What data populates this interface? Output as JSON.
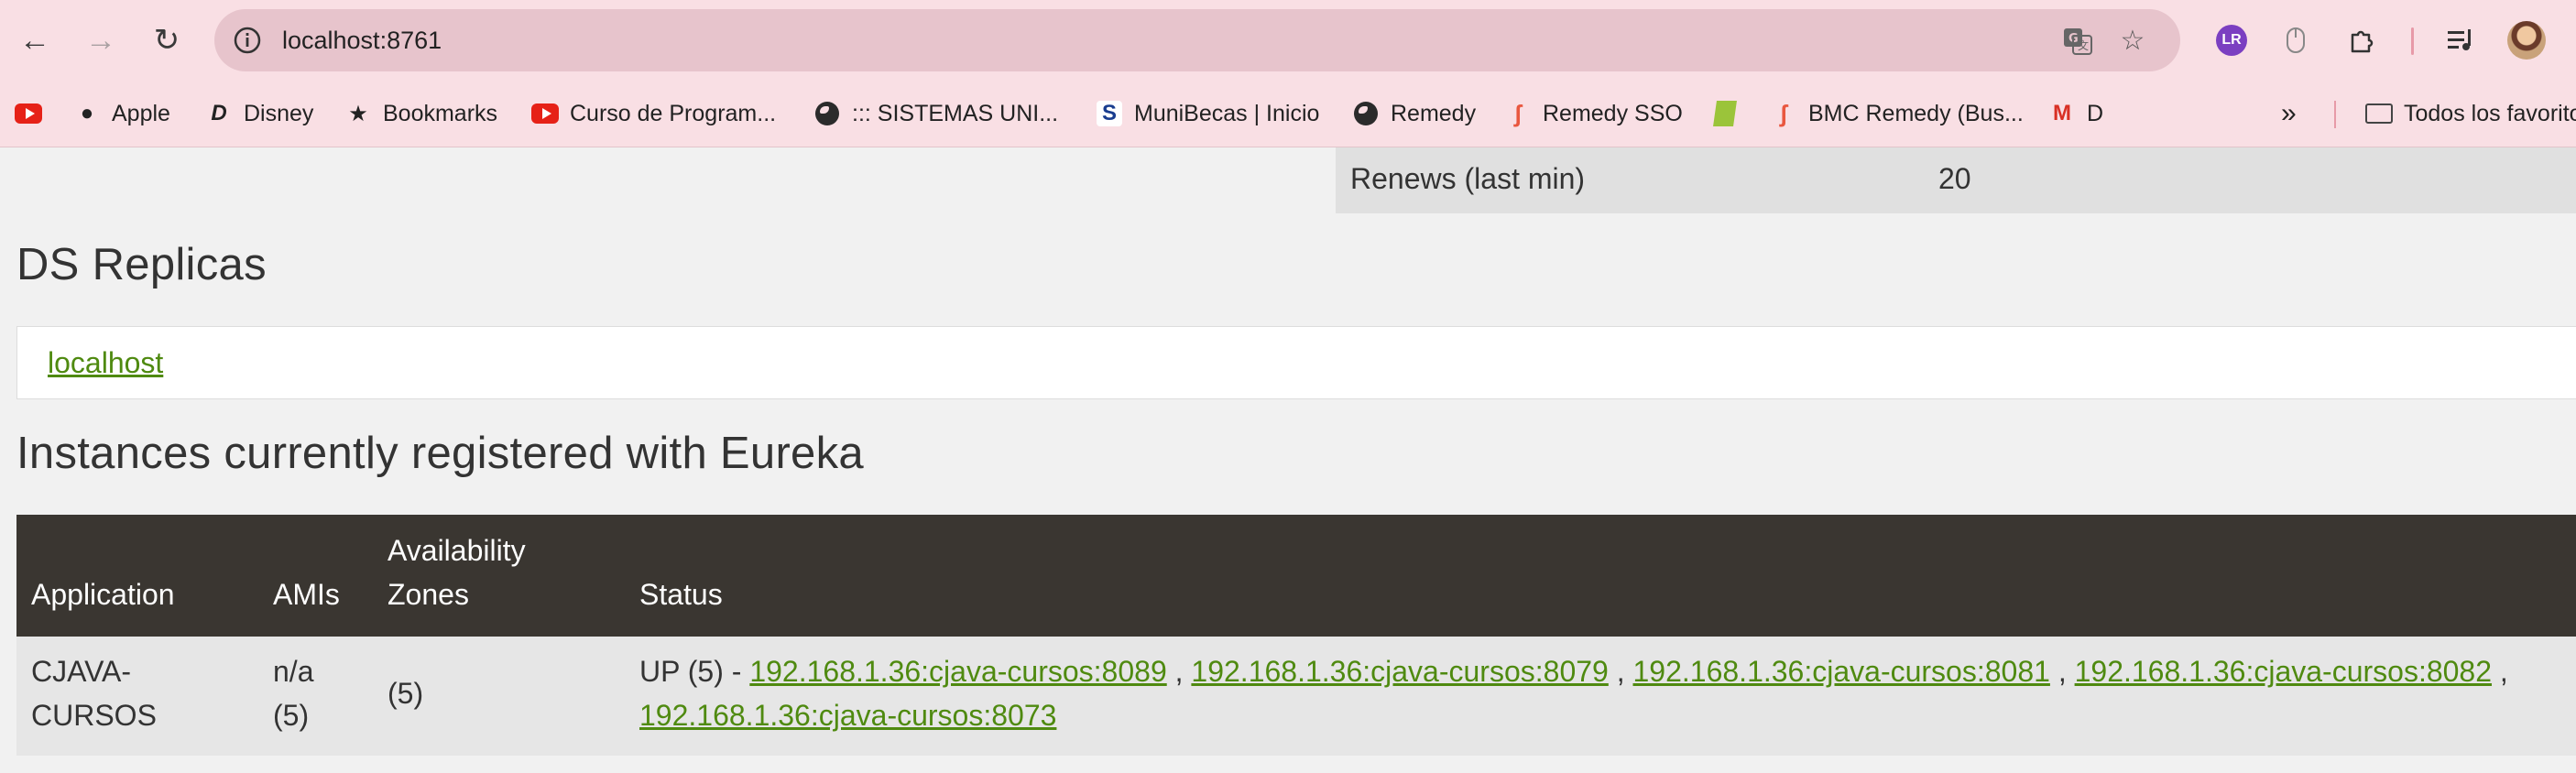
{
  "browser": {
    "url": "localhost:8761",
    "bookmarks": [
      {
        "label": "",
        "icon": "youtube-icon"
      },
      {
        "label": "Apple",
        "icon": "apple-icon"
      },
      {
        "label": "Disney",
        "icon": "disney-icon"
      },
      {
        "label": "Bookmarks",
        "icon": "star-icon"
      },
      {
        "label": "Curso de Program...",
        "icon": "youtube-icon"
      },
      {
        "label": "::: SISTEMAS UNI...",
        "icon": "globe-icon"
      },
      {
        "label": "MuniBecas | Inicio",
        "icon": "munibecas-icon"
      },
      {
        "label": "Remedy",
        "icon": "globe-icon"
      },
      {
        "label": "Remedy SSO",
        "icon": "bmc-icon"
      },
      {
        "label": "",
        "icon": "green-bookmark-icon"
      },
      {
        "label": "BMC Remedy (Bus...",
        "icon": "bmc-icon"
      },
      {
        "label": "D",
        "icon": "gmail-icon"
      }
    ],
    "overflow_glyph": "»",
    "all_bookmarks_label": "Todos los favoritos",
    "ext_avatar_text": "LR"
  },
  "stats": {
    "renews_label": "Renews (last min)",
    "renews_value": "20"
  },
  "replicas": {
    "heading": "DS Replicas",
    "link": "localhost"
  },
  "instances": {
    "heading": "Instances currently registered with Eureka",
    "columns": {
      "application": "Application",
      "amis": "AMIs",
      "zones_line1": "Availability",
      "zones_line2": "Zones",
      "status": "Status"
    },
    "rows": [
      {
        "application_line1": "CJAVA-",
        "application_line2": "CURSOS",
        "amis_line1": "n/a",
        "amis_line2": "(5)",
        "zones": "(5)",
        "status_prefix": "UP (5) - ",
        "links": [
          "192.168.1.36:cjava-cursos:8089",
          "192.168.1.36:cjava-cursos:8079",
          "192.168.1.36:cjava-cursos:8081",
          "192.168.1.36:cjava-cursos:8082",
          "192.168.1.36:cjava-cursos:8073"
        ],
        "separator": " , "
      }
    ]
  },
  "colors": {
    "chrome_bg": "#f9dfe4",
    "omnibox_bg": "#e7c4cc",
    "page_bg": "#f1f1f1",
    "table_header_bg": "#3a3631",
    "link_green": "#4f8a10"
  }
}
